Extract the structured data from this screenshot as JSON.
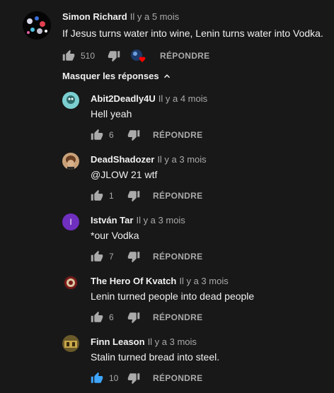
{
  "main_comment": {
    "author": "Simon Richard",
    "time": "Il y a 5 mois",
    "text": "If Jesus turns water into wine, Lenin turns water into Vodka.",
    "likes": "510",
    "reply_label": "RÉPONDRE"
  },
  "toggle_label": "Masquer les réponses",
  "replies": [
    {
      "author": "Abit2Deadly4U",
      "time": "Il y a 4 mois",
      "text": "Hell yeah",
      "likes": "6",
      "reply_label": "RÉPONDRE",
      "avatar_color": "#2a7f7a"
    },
    {
      "author": "DeadShadozer",
      "time": "Il y a 3 mois",
      "text": "@JLOW 21 wtf",
      "likes": "1",
      "reply_label": "RÉPONDRE",
      "avatar_color": "#8a5a3a"
    },
    {
      "author": "István Tar",
      "time": "Il y a 3 mois",
      "text": "*our Vodka",
      "likes": "7",
      "reply_label": "RÉPONDRE",
      "avatar_color": "#6f2fbf",
      "avatar_letter": "I"
    },
    {
      "author": "The Hero Of Kvatch",
      "time": "Il y a 3 mois",
      "text": "Lenin turned people into dead people",
      "likes": "6",
      "reply_label": "RÉPONDRE",
      "avatar_color": "#7a1a1a"
    },
    {
      "author": "Finn Leason",
      "time": "Il y a 3 mois",
      "text": "Stalin turned bread into steel.",
      "likes": "10",
      "reply_label": "RÉPONDRE",
      "avatar_color": "#a68a3a",
      "liked": true
    }
  ],
  "colors": {
    "liked_blue": "#3ea6ff",
    "muted": "#aaaaaa",
    "heart_red": "#ff0000"
  }
}
